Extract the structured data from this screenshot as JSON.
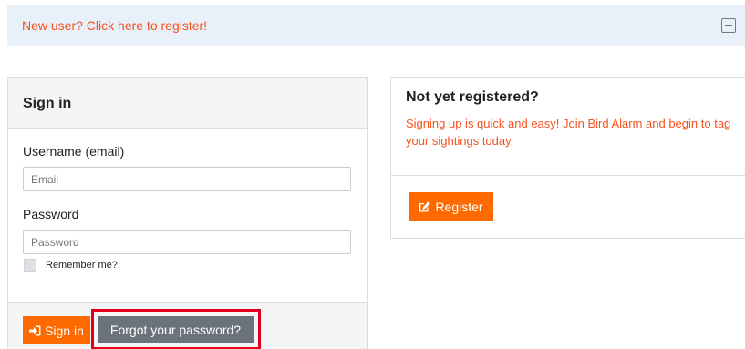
{
  "banner": {
    "link_text": "New user? Click here to register!",
    "collapse_icon": "minus-square-icon"
  },
  "signin": {
    "title": "Sign in",
    "username_label": "Username (email)",
    "email_placeholder": "Email",
    "email_value": "",
    "password_label": "Password",
    "password_placeholder": "Password",
    "password_value": "",
    "remember_label": "Remember me?",
    "remember_checked": false,
    "signin_button": "Sign in",
    "signin_icon": "sign-in-icon",
    "forgot_button": "Forgot your password?"
  },
  "register": {
    "title": "Not yet registered?",
    "text": "Signing up is quick and easy! Join Bird Alarm and begin to tag your sightings today.",
    "button": "Register",
    "button_icon": "edit-icon"
  },
  "colors": {
    "accent": "#ff6a00",
    "link": "#f4511e",
    "highlight": "#e0001b",
    "secondary_button": "#6a737c",
    "banner_bg": "#e8f0fa"
  }
}
